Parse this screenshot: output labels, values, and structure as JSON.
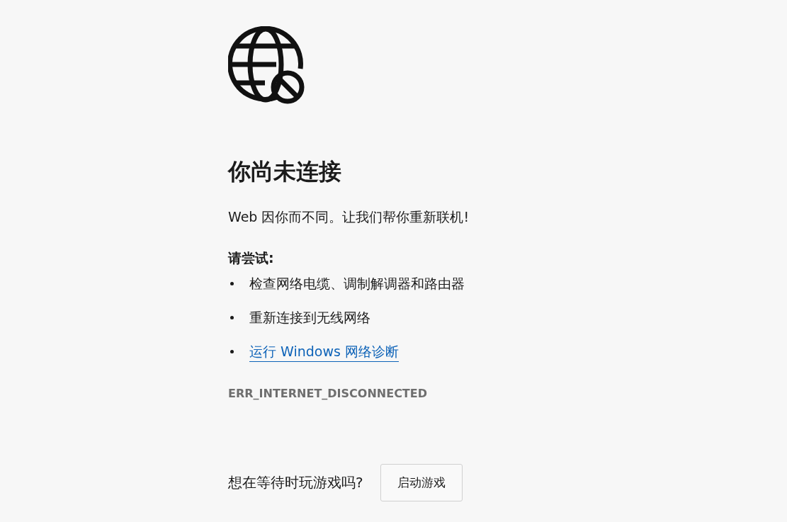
{
  "heading": "你尚未连接",
  "message": "Web 因你而不同。让我们帮你重新联机!",
  "suggestions_title": "请尝试:",
  "suggestions": [
    {
      "kind": "text",
      "text": "检查网络电缆、调制解调器和路由器"
    },
    {
      "kind": "text",
      "text": "重新连接到无线网络"
    },
    {
      "kind": "link",
      "text": "运行 Windows 网络诊断"
    }
  ],
  "error_code": "ERR_INTERNET_DISCONNECTED",
  "game": {
    "prompt": "想在等待时玩游戏吗?",
    "button": "启动游戏"
  }
}
